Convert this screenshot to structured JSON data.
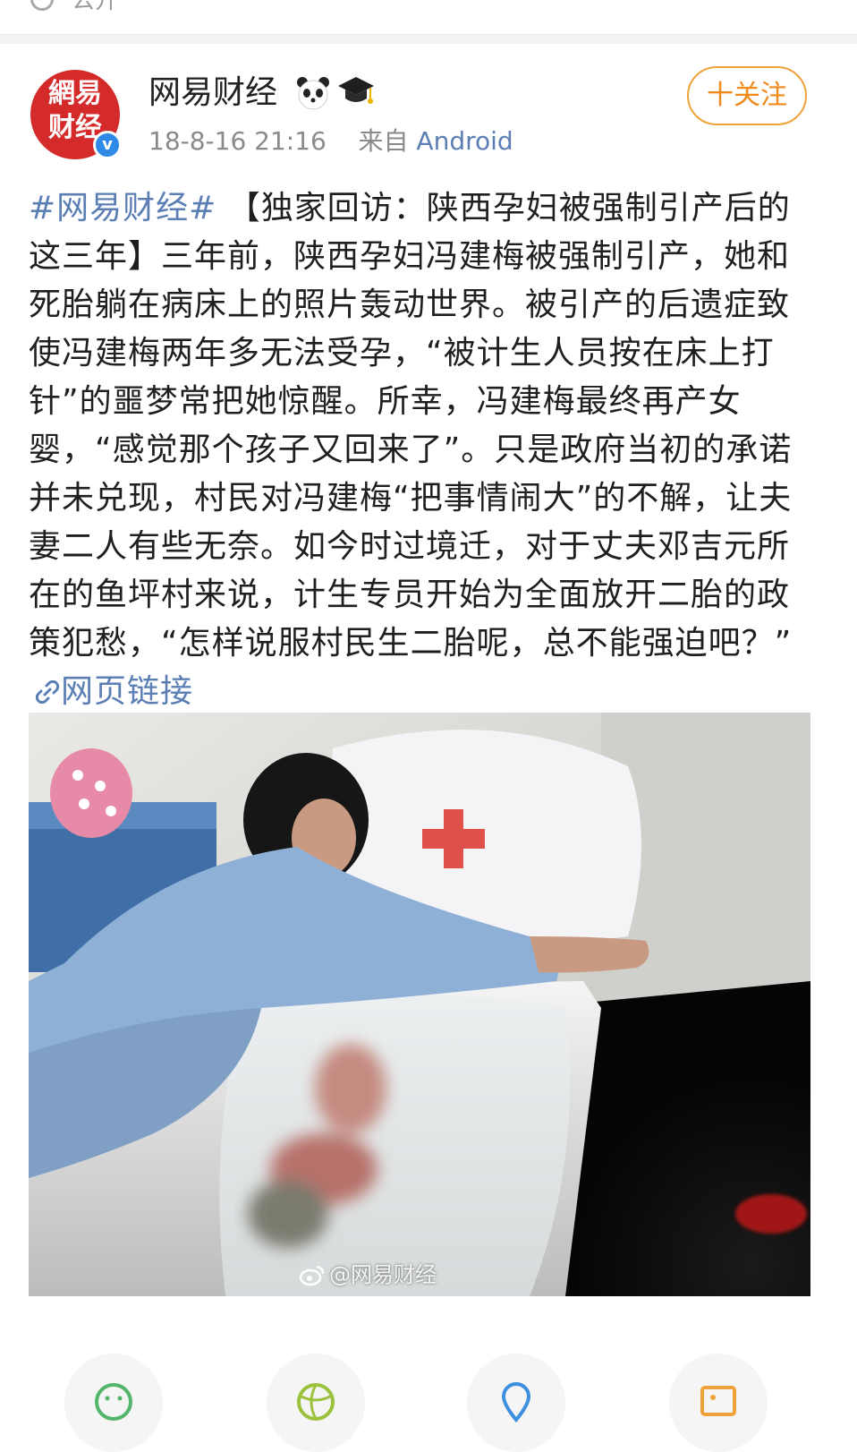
{
  "topbar": {
    "visibility_label": "公开",
    "visibility_icon": "globe-icon"
  },
  "post": {
    "author": {
      "name": "网易财经",
      "avatar_text_line1": "網易",
      "avatar_text_line2": "财经",
      "verified_mark": "v",
      "badges": [
        "panda-badge-icon",
        "graduation-cap-badge-icon"
      ]
    },
    "timestamp": "18-8-16 21:16",
    "source_prefix": "来自",
    "source": "Android",
    "follow_label": "十关注",
    "text": {
      "hashtag": "#网易财经#",
      "body": " 【独家回访：陕西孕妇被强制引产后的这三年】三年前，陕西孕妇冯建梅被强制引产，她和死胎躺在病床上的照片轰动世界。被引产的后遗症致使冯建梅两年多无法受孕，“被计生人员按在床上打针”的噩梦常把她惊醒。所幸，冯建梅最终再产女婴，“感觉那个孩子又回来了”。只是政府当初的承诺并未兑现，村民对冯建梅“把事情闹大”的不解，让夫妻二人有些无奈。如今时过境迁，对于丈夫邓吉元所在的鱼坪村来说，计生专员开始为全面放开二胎的政策犯愁，“怎样说服村民生二胎呢，总不能强迫吧？”",
      "link_label": "网页链接"
    },
    "photo": {
      "watermark": "@网易财经",
      "pillow_cross_color": "#d8342c"
    },
    "actions": [
      "emoji-icon",
      "globe-icon",
      "location-icon",
      "image-icon"
    ]
  },
  "colors": {
    "link": "#5b7fb5",
    "follow": "#f08a1a",
    "avatar_bg": "#d42a2a",
    "verified": "#2e8ae6"
  }
}
